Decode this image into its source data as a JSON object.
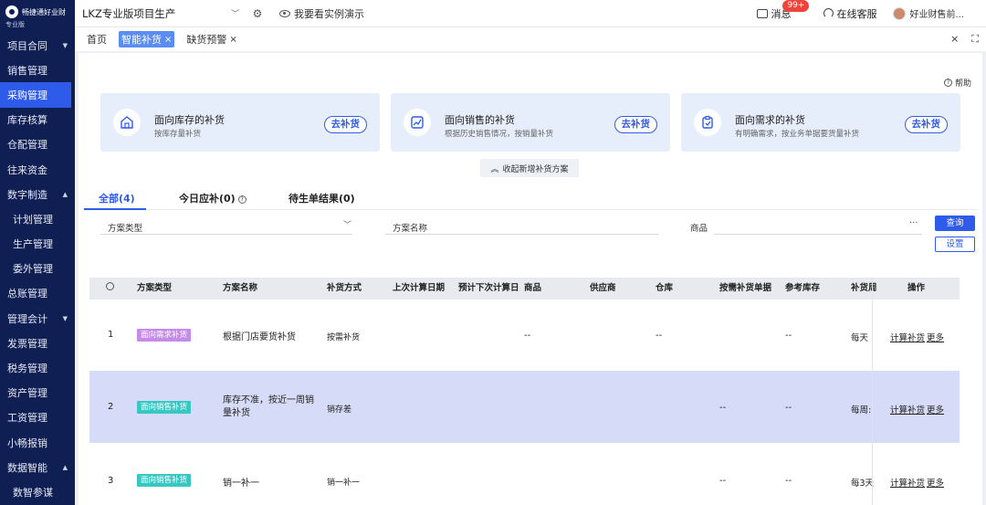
{
  "sidebar": {
    "logo_text": "畅捷通好业财",
    "logo_sub": "专业版",
    "items": [
      {
        "label": "项目合同",
        "caret": "▼",
        "sub": false,
        "active": false
      },
      {
        "label": "销售管理",
        "caret": "",
        "sub": false,
        "active": false
      },
      {
        "label": "采购管理",
        "caret": "",
        "sub": false,
        "active": true
      },
      {
        "label": "库存核算",
        "caret": "",
        "sub": false,
        "active": false
      },
      {
        "label": "仓配管理",
        "caret": "",
        "sub": false,
        "active": false
      },
      {
        "label": "往来资金",
        "caret": "",
        "sub": false,
        "active": false
      },
      {
        "label": "数字制造",
        "caret": "▲",
        "sub": false,
        "active": false
      },
      {
        "label": "计划管理",
        "caret": "",
        "sub": true,
        "active": false
      },
      {
        "label": "生产管理",
        "caret": "",
        "sub": true,
        "active": false
      },
      {
        "label": "委外管理",
        "caret": "",
        "sub": true,
        "active": false
      },
      {
        "label": "总账管理",
        "caret": "",
        "sub": false,
        "active": false
      },
      {
        "label": "管理会计",
        "caret": "▼",
        "sub": false,
        "active": false
      },
      {
        "label": "发票管理",
        "caret": "",
        "sub": false,
        "active": false
      },
      {
        "label": "税务管理",
        "caret": "",
        "sub": false,
        "active": false
      },
      {
        "label": "资产管理",
        "caret": "",
        "sub": false,
        "active": false
      },
      {
        "label": "工资管理",
        "caret": "",
        "sub": false,
        "active": false
      },
      {
        "label": "小畅报销",
        "caret": "",
        "sub": false,
        "active": false
      },
      {
        "label": "数据智能",
        "caret": "▲",
        "sub": false,
        "active": false
      },
      {
        "label": "数智参谋",
        "caret": "",
        "sub": true,
        "active": false
      }
    ]
  },
  "topbar": {
    "project": "LKZ专业版项目生产",
    "demo": "我要看实例演示",
    "messages": "消息",
    "badge": "99+",
    "service": "在线客服",
    "user": "好业财售前..."
  },
  "tabs": {
    "home": "首页",
    "items": [
      {
        "label": "智能补货",
        "close": "×",
        "active": true
      },
      {
        "label": "缺货预警",
        "close": "×",
        "active": false
      }
    ],
    "close_all": "×",
    "fullscreen": "⛶"
  },
  "help": "帮助",
  "cards": [
    {
      "title": "面向库存的补货",
      "desc": "按库存量补货",
      "button": "去补货",
      "icon": "warehouse-icon"
    },
    {
      "title": "面向销售的补货",
      "desc": "根据历史销售情况，按销量补货",
      "button": "去补货",
      "icon": "sales-chart-icon"
    },
    {
      "title": "面向需求的补货",
      "desc": "有明确需求，按业务单据要货量补货",
      "button": "去补货",
      "icon": "clipboard-icon"
    }
  ],
  "collapse_label": "收起新增补货方案",
  "list_tabs": [
    "全部(4)",
    "今日应补(0)",
    "待生单结果(0)"
  ],
  "filters": {
    "plan_type": "方案类型",
    "plan_name": "方案名称",
    "product": "商品",
    "more": "···",
    "query": "查询",
    "settings": "设置"
  },
  "table": {
    "columns": [
      "方案类型",
      "方案名称",
      "补货方式",
      "上次计算日期",
      "预计下次计算日",
      "商品",
      "供应商",
      "仓库",
      "按需补货单据",
      "参考库存",
      "补货周",
      "操作"
    ],
    "rows": [
      {
        "index": "1",
        "type": "面向需求补货",
        "type_color": "purple",
        "name": "根据门店要货补货",
        "method": "按需补货",
        "product": "--",
        "warehouse": "--",
        "demand_doc": "",
        "ref_stock": "--",
        "cycle": "每天",
        "calc": "计算补货",
        "more": "更多"
      },
      {
        "index": "2",
        "type": "面向销售补货",
        "type_color": "teal",
        "name": "库存不准，按近一周销量补货",
        "method": "销存差",
        "product": "",
        "warehouse": "",
        "demand_doc": "--",
        "ref_stock": "--",
        "cycle": "每周:",
        "calc": "计算补货",
        "more": "更多"
      },
      {
        "index": "3",
        "type": "面向销售补货",
        "type_color": "teal",
        "name": "销一补一",
        "method": "销一补一",
        "product": "",
        "warehouse": "",
        "demand_doc": "--",
        "ref_stock": "--",
        "cycle": "每3天",
        "calc": "计算补货",
        "more": "更多"
      }
    ]
  }
}
